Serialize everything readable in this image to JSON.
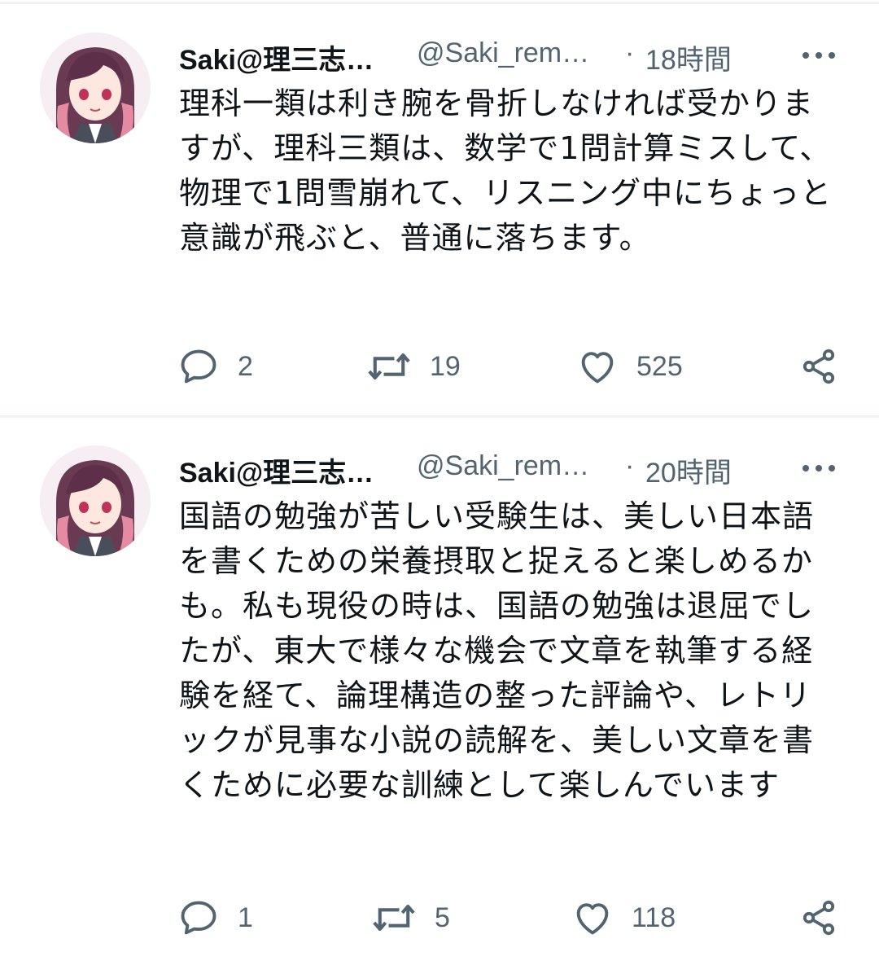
{
  "tweets": [
    {
      "display_name": "Saki@理三志…",
      "handle": "@Saki_rem…",
      "separator": "·",
      "time": "18時間",
      "text": "理科一類は利き腕を骨折しなければ受かりますが、理科三類は、数学で1問計算ミスして、物理で1問雪崩れて、リスニング中にちょっと意識が飛ぶと、普通に落ちます。",
      "replies": "2",
      "retweets": "19",
      "likes": "525",
      "avatar_icon": "avatar-anime-girl-icon",
      "more_icon": "more-dots-icon",
      "reply_icon": "reply-bubble-icon",
      "retweet_icon": "retweet-arrows-icon",
      "like_icon": "heart-icon",
      "share_icon": "share-icon"
    },
    {
      "display_name": "Saki@理三志…",
      "handle": "@Saki_rem…",
      "separator": "·",
      "time": "20時間",
      "text": "国語の勉強が苦しい受験生は、美しい日本語を書くための栄養摂取と捉えると楽しめるかも。私も現役の時は、国語の勉強は退屈でしたが、東大で様々な機会で文章を執筆する経験を経て、論理構造の整った評論や、レトリックが見事な小説の読解を、美しい文章を書くために必要な訓練として楽しんでいます",
      "replies": "1",
      "retweets": "5",
      "likes": "118",
      "avatar_icon": "avatar-anime-girl-icon",
      "more_icon": "more-dots-icon",
      "reply_icon": "reply-bubble-icon",
      "retweet_icon": "retweet-arrows-icon",
      "like_icon": "heart-icon",
      "share_icon": "share-icon"
    }
  ],
  "colors": {
    "text_primary": "#0f1419",
    "text_secondary": "#536471",
    "divider": "#eff3f4"
  }
}
